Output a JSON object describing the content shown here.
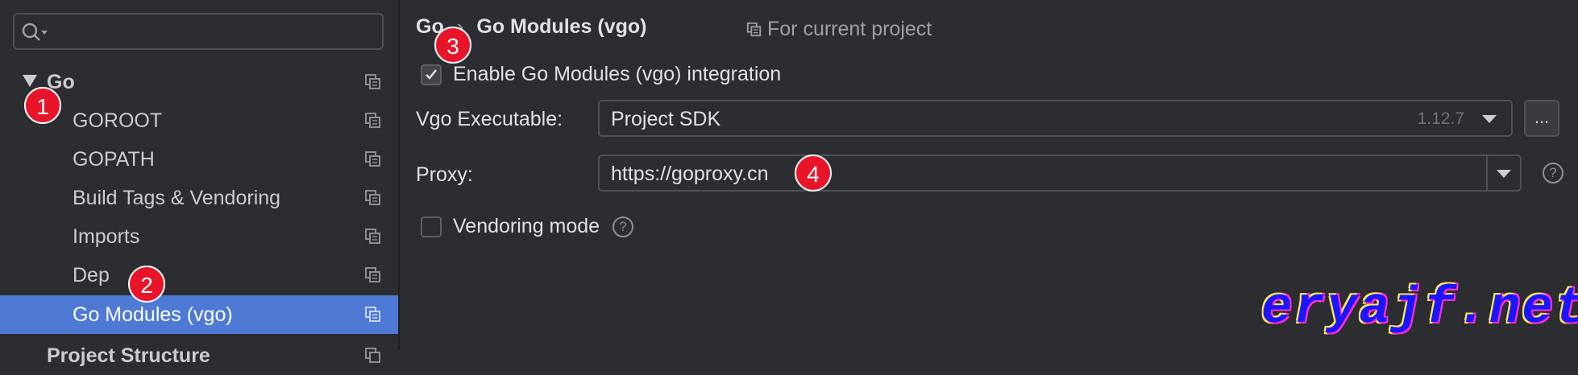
{
  "sidebar": {
    "search": {
      "placeholder": ""
    },
    "tree": {
      "root": {
        "label": "Go",
        "expanded": true
      },
      "items": [
        {
          "label": "GOROOT"
        },
        {
          "label": "GOPATH"
        },
        {
          "label": "Build Tags & Vendoring"
        },
        {
          "label": "Imports"
        },
        {
          "label": "Dep"
        },
        {
          "label": "Go Modules (vgo)",
          "selected": true
        }
      ],
      "next_root_partial": {
        "label": "Project Structure"
      }
    }
  },
  "main": {
    "breadcrumb": [
      "Go",
      "Go Modules (vgo)"
    ],
    "breadcrumb_separator": "›",
    "scope_label": "For current project",
    "enable_integration": {
      "label": "Enable Go Modules (vgo) integration",
      "checked": true
    },
    "vgo_executable": {
      "label": "Vgo Executable:",
      "value": "Project SDK",
      "version": "1.12.7",
      "browse_label": "..."
    },
    "proxy": {
      "label": "Proxy:",
      "value": "https://goproxy.cn",
      "help": "?"
    },
    "vendoring_mode": {
      "label": "Vendoring mode",
      "checked": false,
      "help": "?"
    }
  },
  "annotations": [
    "1",
    "2",
    "3",
    "4"
  ],
  "watermark": "eryajf.net",
  "colors": {
    "background": "#2b2d30",
    "selection": "#4e7ad6",
    "annotation_badge": "#e8152a",
    "text": "#dfe1e5"
  }
}
